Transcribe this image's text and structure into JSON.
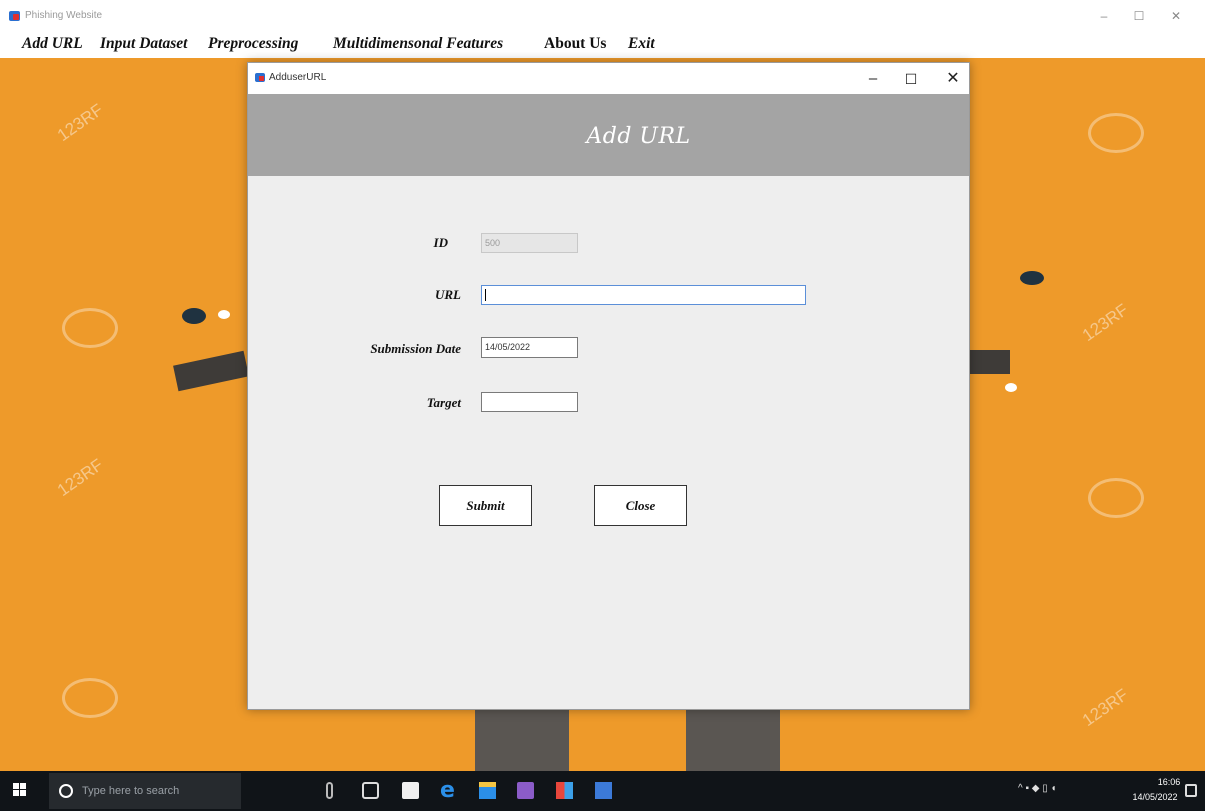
{
  "app": {
    "title": "Phishing Website",
    "controls": {
      "minimize": "–",
      "maximize": "☐",
      "close": "✕"
    }
  },
  "menu": {
    "items": [
      {
        "label": "Add URL"
      },
      {
        "label": "Input Dataset"
      },
      {
        "label": "Preprocessing"
      },
      {
        "label": "Multidimensonal Features"
      },
      {
        "label": "About Us"
      },
      {
        "label": "Exit"
      }
    ]
  },
  "background": {
    "watermark": "123RF",
    "colors": {
      "orange": "#ee9a2a"
    }
  },
  "dialog": {
    "title": "AdduserURL",
    "controls": {
      "minimize": "–",
      "maximize": "☐",
      "close": "✕"
    },
    "heading": "Add URL",
    "form": {
      "id_label": "ID",
      "id_value": "500",
      "url_label": "URL",
      "url_value": "",
      "date_label": "Submission Date",
      "date_value": "14/05/2022",
      "target_label": "Target",
      "target_value": ""
    },
    "buttons": {
      "submit": "Submit",
      "close": "Close"
    },
    "colors": {
      "header": "#a4a4a4",
      "body": "#eeeeee"
    }
  },
  "taskbar": {
    "search_placeholder": "Type here to search",
    "tray": "^",
    "time": "16:06",
    "date": "14/05/2022"
  }
}
